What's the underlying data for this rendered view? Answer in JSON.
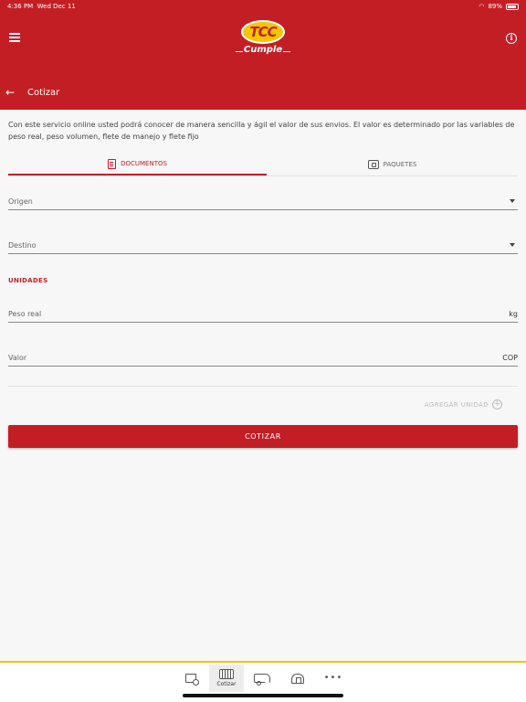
{
  "status_bar": {
    "time": "4:36 PM",
    "date": "Wed Dec 11",
    "battery": "89%"
  },
  "header": {
    "logo_text": "TCC",
    "logo_sub": "Cumple",
    "page_title": "Cotizar"
  },
  "description": "Con este servicio online usted podrá conocer de manera sencilla y ágil el valor de sus envios. El valor es determinado por las variables de peso real, peso volumen, flete de manejo y flete fijo",
  "tabs": [
    {
      "label": "DOCUMENTOS",
      "icon": "document-icon",
      "active": true
    },
    {
      "label": "PAQUETES",
      "icon": "package-icon",
      "active": false
    }
  ],
  "form": {
    "origen_label": "Origen",
    "destino_label": "Destino",
    "unidades_label": "UNIDADES",
    "peso_label": "Peso real",
    "peso_unit": "kg",
    "valor_label": "Valor",
    "valor_unit": "COP",
    "add_unit_label": "AGREGAR UNIDAD",
    "submit_label": "COTIZAR"
  },
  "bottom_nav": [
    {
      "label": "",
      "icon": "tracking-icon",
      "active": false
    },
    {
      "label": "Cotizar",
      "icon": "calculator-icon",
      "active": true
    },
    {
      "label": "",
      "icon": "truck-icon",
      "active": false
    },
    {
      "label": "",
      "icon": "store-icon",
      "active": false
    },
    {
      "label": "",
      "icon": "more-icon",
      "active": false
    }
  ],
  "colors": {
    "brand_red": "#c41e25",
    "brand_yellow": "#f1c400"
  }
}
